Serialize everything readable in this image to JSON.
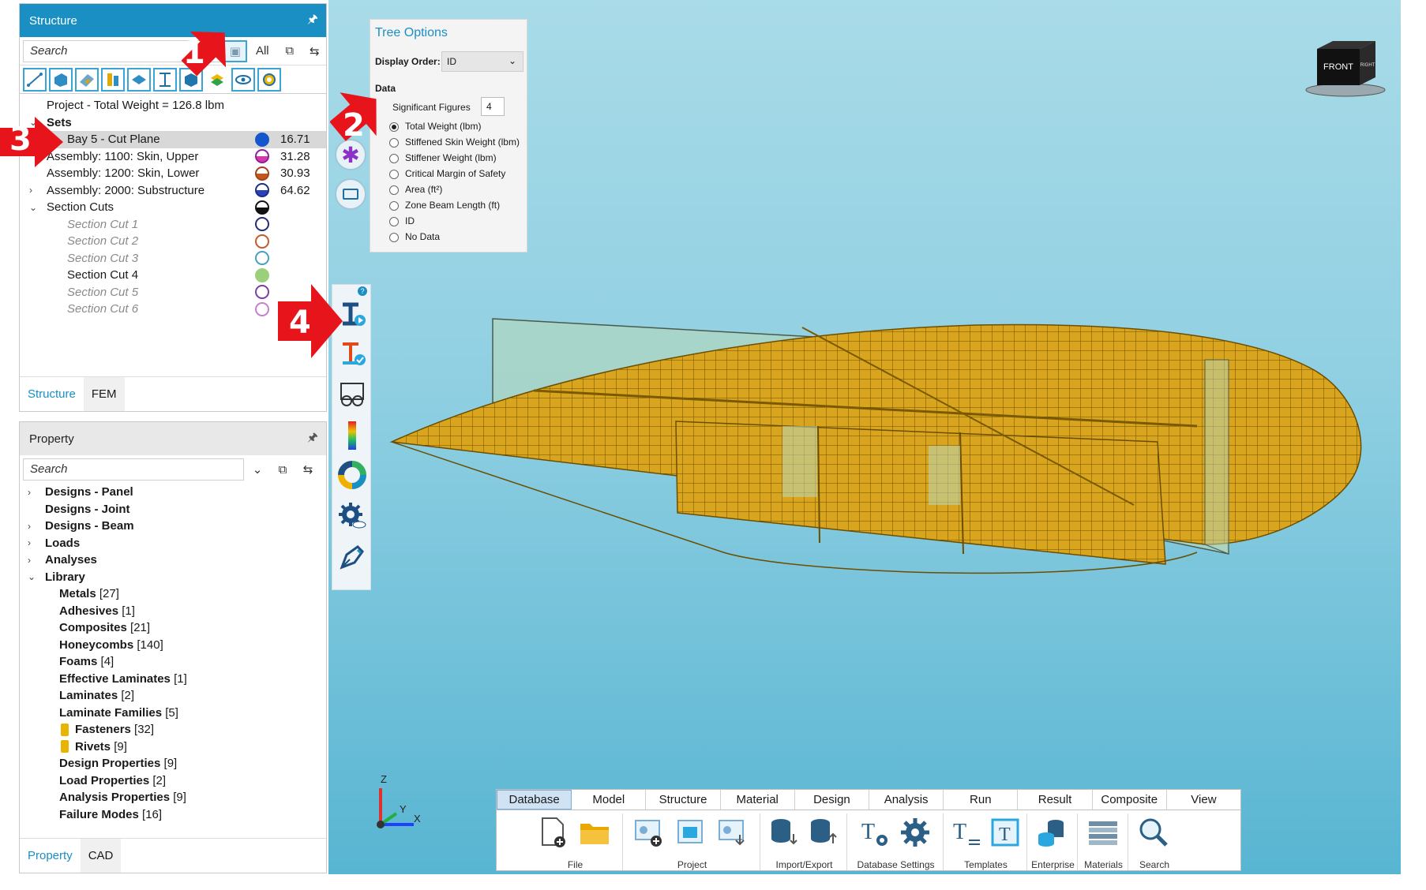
{
  "structure_panel": {
    "title": "Structure",
    "search_placeholder": "Search",
    "filter_all": "All",
    "tree": [
      {
        "label": "Project - Total Weight = 126.8 lbm",
        "value": "",
        "level": 1
      },
      {
        "label": "Sets",
        "value": "",
        "level": 1
      },
      {
        "label": "Bay 5 - Cut Plane",
        "value": "16.71",
        "level": 2
      },
      {
        "label": "Assembly: 1100: Skin, Upper",
        "value": "31.28",
        "level": 1
      },
      {
        "label": "Assembly: 1200: Skin, Lower",
        "value": "30.93",
        "level": 1
      },
      {
        "label": "Assembly: 2000: Substructure",
        "value": "64.62",
        "level": 1
      },
      {
        "label": "Section Cuts",
        "value": "",
        "level": 1
      },
      {
        "label": "Section Cut 1",
        "value": "",
        "level": 2
      },
      {
        "label": "Section Cut 2",
        "value": "",
        "level": 2
      },
      {
        "label": "Section Cut 3",
        "value": "",
        "level": 2
      },
      {
        "label": "Section Cut 4",
        "value": "",
        "level": 2
      },
      {
        "label": "Section Cut 5",
        "value": "",
        "level": 2
      },
      {
        "label": "Section Cut 6",
        "value": "",
        "level": 2
      }
    ],
    "tabs": [
      "Structure",
      "FEM"
    ]
  },
  "property_panel": {
    "title": "Property",
    "search_placeholder": "Search",
    "tree": [
      {
        "label": "Designs - Panel",
        "count": ""
      },
      {
        "label": "Designs - Joint",
        "count": ""
      },
      {
        "label": "Designs - Beam",
        "count": ""
      },
      {
        "label": "Loads",
        "count": ""
      },
      {
        "label": "Analyses",
        "count": ""
      },
      {
        "label": "Library",
        "count": ""
      },
      {
        "label": "Metals",
        "count": "[27]"
      },
      {
        "label": "Adhesives",
        "count": "[1]"
      },
      {
        "label": "Composites",
        "count": "[21]"
      },
      {
        "label": "Honeycombs",
        "count": "[140]"
      },
      {
        "label": "Foams",
        "count": "[4]"
      },
      {
        "label": "Effective Laminates",
        "count": "[1]"
      },
      {
        "label": "Laminates",
        "count": "[2]"
      },
      {
        "label": "Laminate Families",
        "count": "[5]"
      },
      {
        "label": "Fasteners",
        "count": "[32]"
      },
      {
        "label": "Rivets",
        "count": "[9]"
      },
      {
        "label": "Design Properties",
        "count": "[9]"
      },
      {
        "label": "Load Properties",
        "count": "[2]"
      },
      {
        "label": "Analysis Properties",
        "count": "[9]"
      },
      {
        "label": "Failure Modes",
        "count": "[16]"
      }
    ],
    "tabs": [
      "Property",
      "CAD"
    ]
  },
  "tree_options": {
    "title": "Tree Options",
    "display_order_label": "Display Order:",
    "display_order_value": "ID",
    "data_heading": "Data",
    "sig_figs_label": "Significant Figures",
    "sig_figs_value": "4",
    "options": [
      "Total Weight (lbm)",
      "Stiffened Skin Weight (lbm)",
      "Stiffener Weight (lbm)",
      "Critical Margin of Safety",
      "Area (ft²)",
      "Zone Beam Length (ft)",
      "ID",
      "No Data"
    ],
    "selected_option": "Total Weight (lbm)"
  },
  "callouts": [
    "1",
    "2",
    "3",
    "4"
  ],
  "view_cube": {
    "front": "FRONT",
    "right": "RIGHT"
  },
  "axes": {
    "z": "Z",
    "y": "Y",
    "x": "X"
  },
  "ribbon": {
    "tabs": [
      "Database",
      "Model",
      "Structure",
      "Material",
      "Design",
      "Analysis",
      "Run",
      "Result",
      "Composite",
      "View"
    ],
    "active_tab": "Database",
    "groups": [
      "File",
      "Project",
      "Import/Export",
      "Database Settings",
      "Templates",
      "Enterprise",
      "Materials",
      "Search"
    ]
  },
  "colors": {
    "accent": "#1a8fc4",
    "callout_red": "#e8141c",
    "model_gold": "#d4a21c",
    "viewport_bg": "#8fcfe2"
  }
}
